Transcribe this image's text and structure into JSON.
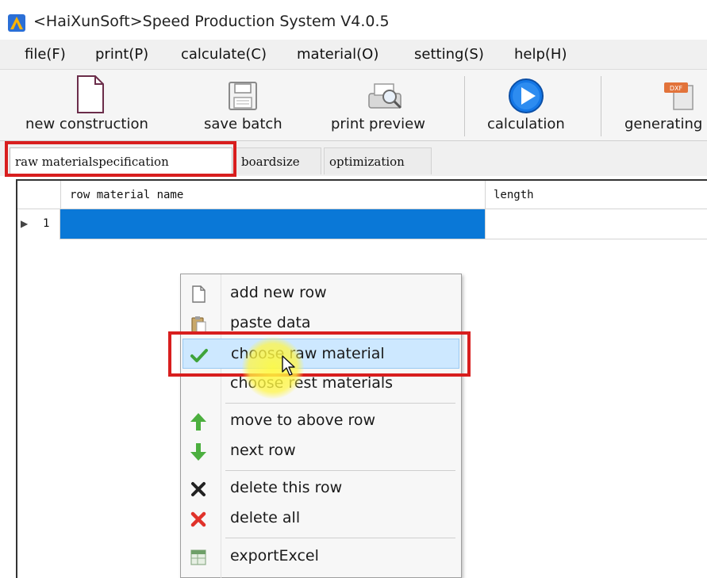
{
  "window": {
    "title": "<HaiXunSoft>Speed Production System V4.0.5",
    "icon": "app-logo-icon"
  },
  "menu": [
    {
      "label": "file(F)"
    },
    {
      "label": "print(P)"
    },
    {
      "label": "calculate(C)"
    },
    {
      "label": "material(O)"
    },
    {
      "label": "setting(S)"
    },
    {
      "label": "help(H)"
    }
  ],
  "toolbar": [
    {
      "label": "new construction",
      "icon": "new-document-icon"
    },
    {
      "label": "save batch",
      "icon": "save-disk-icon"
    },
    {
      "label": "print preview",
      "icon": "print-preview-icon"
    },
    {
      "label": "calculation",
      "icon": "play-circle-icon"
    },
    {
      "label": "generating",
      "icon": "dxf-file-icon",
      "icon_badge": "DXF"
    }
  ],
  "tabs": [
    {
      "label": "raw materialspecification",
      "active": true
    },
    {
      "label": "boardsize",
      "active": false
    },
    {
      "label": "optimization",
      "active": false
    }
  ],
  "grid": {
    "columns": [
      "row material name",
      "length"
    ],
    "rows": [
      {
        "num": "1",
        "name": "",
        "length": "",
        "selected": true
      }
    ]
  },
  "context_menu": {
    "items": [
      {
        "label": "add new row",
        "icon": "blank-page-icon"
      },
      {
        "label": "paste data",
        "icon": "clipboard-icon"
      },
      {
        "label": "choose raw material",
        "icon": "checkmark-icon",
        "highlighted": true
      },
      {
        "label": "choose rest materials",
        "icon": ""
      },
      {
        "label": "move to above row",
        "icon": "arrow-up-icon"
      },
      {
        "label": "next row",
        "icon": "arrow-down-icon"
      },
      {
        "label": "delete this row",
        "icon": "x-black-icon"
      },
      {
        "label": "delete all",
        "icon": "x-red-icon"
      },
      {
        "label": "exportExcel",
        "icon": "excel-icon"
      }
    ]
  },
  "colors": {
    "selection": "#0a78d7",
    "annotation": "#d81e1e",
    "menu_highlight": "#cde8ff"
  }
}
